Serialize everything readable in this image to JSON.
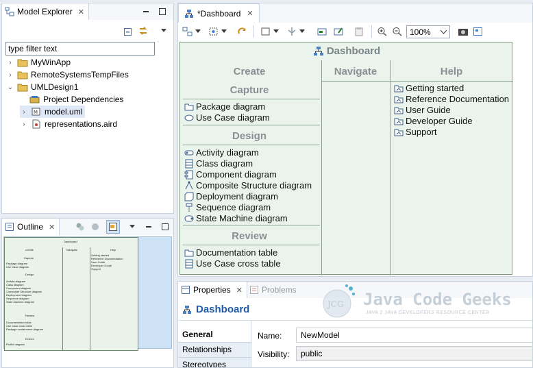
{
  "model_explorer": {
    "title": "Model Explorer",
    "filter_value": "type filter text",
    "tree": [
      {
        "label": "MyWinApp",
        "icon": "project-folder-icon",
        "expanded": false
      },
      {
        "label": "RemoteSystemsTempFiles",
        "icon": "project-folder-icon",
        "expanded": false
      },
      {
        "label": "UMLDesign1",
        "icon": "project-folder-icon",
        "expanded": true
      },
      {
        "label": "Project Dependencies",
        "icon": "dependencies-icon"
      },
      {
        "label": "model.uml",
        "icon": "uml-model-icon",
        "selected": true
      },
      {
        "label": "representations.aird",
        "icon": "aird-file-icon"
      }
    ]
  },
  "outline": {
    "title": "Outline",
    "mini": {
      "title": "Dashboard",
      "create": "Create",
      "navigate": "Navigate",
      "help": "Help",
      "capture": "Capture",
      "design": "Design",
      "review": "Review",
      "extend": "Extend",
      "capture_items": [
        "Package diagram",
        "Use Case diagram"
      ],
      "design_items": [
        "Activity diagram",
        "Class diagram",
        "Component diagram",
        "Composite Structure diagram",
        "Deployment diagram",
        "Sequence diagram",
        "State Machine diagram"
      ],
      "review_items": [
        "Documentation table",
        "Use Case cross table",
        "Package containment diagram"
      ],
      "extend_items": [
        "Profile diagram"
      ],
      "help_items": [
        "Getting started",
        "Reference Documentation",
        "User Guide",
        "Developer Guide",
        "Support"
      ]
    }
  },
  "editor": {
    "tab_label": "*Dashboard",
    "zoom": "100%",
    "dashboard": {
      "title": "Dashboard",
      "columns": {
        "create": "Create",
        "navigate": "Navigate",
        "help": "Help"
      },
      "sections": {
        "capture": "Capture",
        "design": "Design",
        "review": "Review"
      },
      "capture_items": [
        "Package diagram",
        "Use Case diagram"
      ],
      "design_items": [
        "Activity diagram",
        "Class diagram",
        "Component diagram",
        "Composite Structure diagram",
        "Deployment diagram",
        "Sequence diagram",
        "State Machine diagram"
      ],
      "review_items": [
        "Documentation table",
        "Use Case cross table"
      ],
      "help_items": [
        "Getting started",
        "Reference Documentation",
        "User Guide",
        "Developer Guide",
        "Support"
      ]
    }
  },
  "properties": {
    "tab_label": "Properties",
    "problems_label": "Problems",
    "heading": "Dashboard",
    "categories": [
      "General",
      "Relationships",
      "Stereotypes"
    ],
    "name_label": "Name:",
    "name_value": "NewModel",
    "visibility_label": "Visibility:",
    "visibility_value": "public"
  },
  "watermark": {
    "logo": "JCG",
    "brand": "Java Code Geeks",
    "tagline": "JAVA 2 JAVA DEVELOPERS RESOURCE CENTER"
  },
  "colors": {
    "dashboard_bg": "#eaf4ec",
    "accent_blue": "#1f5aa6",
    "section_gray": "#8a8f94"
  }
}
